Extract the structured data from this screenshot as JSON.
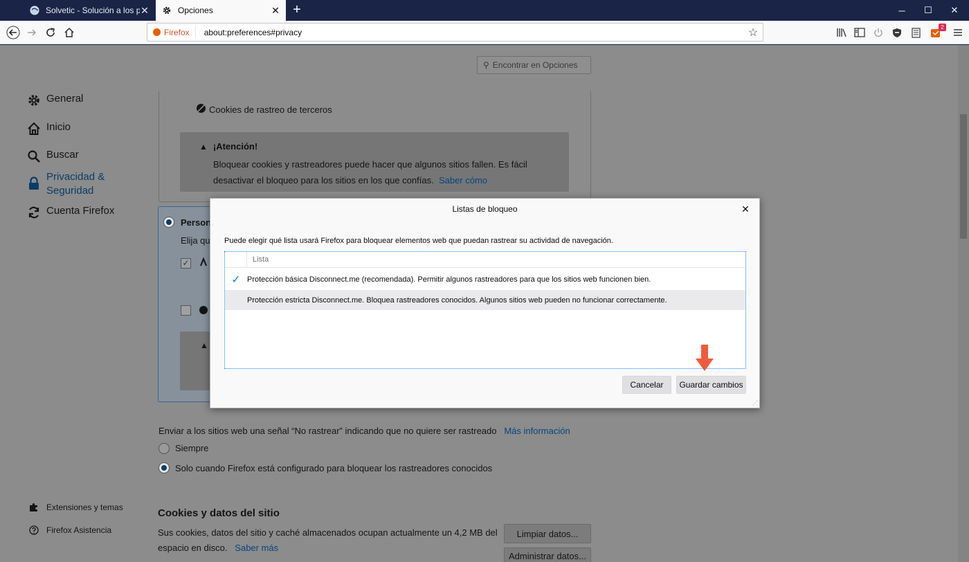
{
  "tabs": [
    {
      "title": "Solvetic - Solución a los proble",
      "active": false
    },
    {
      "title": "Opciones",
      "active": true
    }
  ],
  "urlbar": {
    "identity": "Firefox",
    "url": "about:preferences#privacy"
  },
  "toolbar": {
    "addon_badge": "2"
  },
  "search": {
    "placeholder": "Encontrar en Opciones"
  },
  "sidebar": {
    "items": [
      {
        "label": "General",
        "icon": "gear-icon"
      },
      {
        "label": "Inicio",
        "icon": "home-icon"
      },
      {
        "label": "Buscar",
        "icon": "search-icon"
      },
      {
        "label": "Privacidad &",
        "label2": "Seguridad",
        "icon": "lock-icon",
        "selected": true
      },
      {
        "label": "Cuenta Firefox",
        "icon": "sync-icon"
      }
    ],
    "footer": [
      {
        "label": "Extensiones y temas",
        "icon": "puzzle-icon"
      },
      {
        "label": "Firefox Asistencia",
        "icon": "help-icon"
      }
    ]
  },
  "content": {
    "cookies_tracking": "Cookies de rastreo de terceros",
    "warning": {
      "title": "¡Atención!",
      "text": "Bloquear cookies y rastreadores puede hacer que algunos sitios fallen. Es fácil desactivar el bloqueo para los sitios en los que confías.",
      "link": "Saber cómo"
    },
    "custom_title_partial": "Persona",
    "custom_desc_partial": "Elija qu",
    "dnt": {
      "text": "Enviar a los sitios web una señal “No rastrear” indicando que no quiere ser rastreado",
      "link": "Más información",
      "option_always": "Siempre",
      "option_when_blocking": "Solo cuando Firefox está configurado para bloquear los rastreadores conocidos"
    },
    "cookies_section": {
      "title": "Cookies y datos del sitio",
      "text_line1": "Sus cookies, datos del sitio y caché almacenados ocupan actualmente un 4,2 MB del",
      "text_line2": "espacio en disco.",
      "link": "Saber más",
      "clear_button": "Limpiar datos...",
      "manage_button": "Administrar datos..."
    }
  },
  "dialog": {
    "title": "Listas de bloqueo",
    "description": "Puede elegir qué lista usará Firefox para bloquear elementos web que puedan rastrear su actividad de navegación.",
    "column_header": "Lista",
    "rows": [
      {
        "label": "Protección básica Disconnect.me (recomendada). Permitir algunos rastreadores para que los sitios web funcionen bien.",
        "checked": true
      },
      {
        "label": "Protección estricta Disconnect.me. Bloquea rastreadores conocidos. Algunos sitios web pueden no funcionar correctamente.",
        "checked": false
      }
    ],
    "cancel": "Cancelar",
    "save": "Guardar cambios",
    "check_mark": "✓"
  },
  "colors": {
    "accent": "#0a84ff",
    "annotation_arrow": "#f05a3c",
    "link": "#0060df"
  }
}
